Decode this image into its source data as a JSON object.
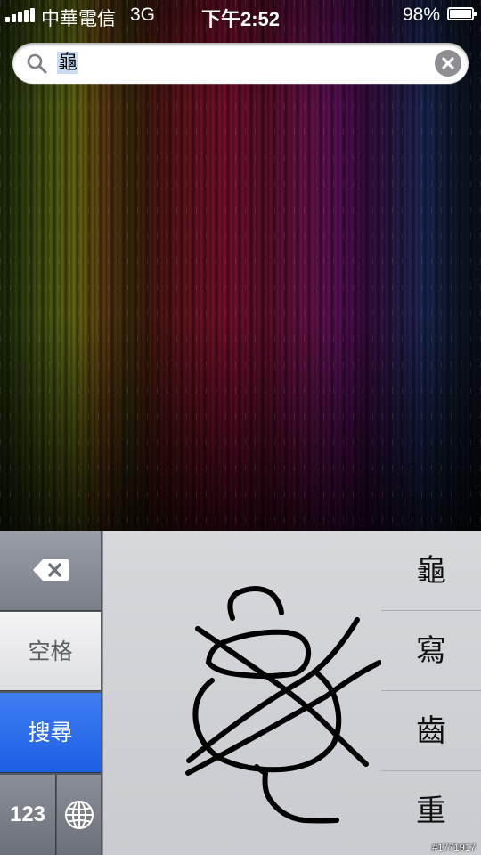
{
  "status_bar": {
    "carrier": "中華電信",
    "network": "3G",
    "time": "下午2:52",
    "battery": "98%",
    "battery_level": 0.98
  },
  "search": {
    "value": "龜",
    "icon": "magnifier-icon",
    "clear_icon": "clear-x-icon"
  },
  "keyboard": {
    "delete_icon": "backspace-icon",
    "space_label": "空格",
    "search_label": "搜尋",
    "numbers_label": "123",
    "globe_icon": "globe-icon",
    "candidates": [
      "龜",
      "寫",
      "齒",
      "重"
    ]
  },
  "watermark": "#1771917",
  "colors": {
    "search_key": "#2566ea",
    "keyboard_bg": "#c9cbd0",
    "stroke": "#000000"
  }
}
